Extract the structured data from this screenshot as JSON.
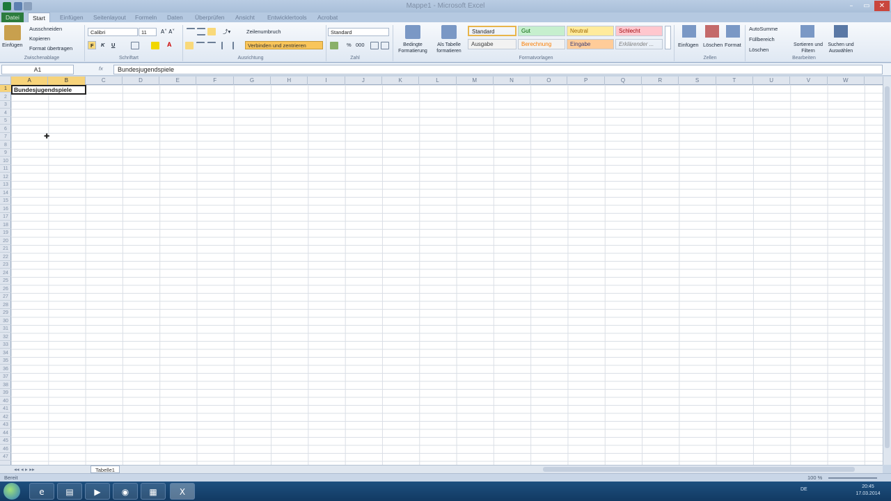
{
  "window": {
    "title": "Mappe1 - Microsoft Excel",
    "minimize": "–",
    "maximize": "▭",
    "close": "✕"
  },
  "tabs": [
    {
      "label": "Datei",
      "active": false,
      "file": true
    },
    {
      "label": "Start",
      "active": true
    },
    {
      "label": "Einfügen"
    },
    {
      "label": "Seitenlayout"
    },
    {
      "label": "Formeln"
    },
    {
      "label": "Daten"
    },
    {
      "label": "Überprüfen"
    },
    {
      "label": "Ansicht"
    },
    {
      "label": "Entwicklertools"
    },
    {
      "label": "Acrobat"
    }
  ],
  "ribbon": {
    "clipboard": {
      "paste": "Einfügen",
      "cut": "Ausschneiden",
      "copy": "Kopieren",
      "format_painter": "Format übertragen",
      "group": "Zwischenablage"
    },
    "font": {
      "name": "Calibri",
      "size": "11",
      "bold": "F",
      "italic": "K",
      "underline": "U",
      "group": "Schriftart"
    },
    "alignment": {
      "wrap": "Zeilenumbruch",
      "merge": "Verbinden und zentrieren",
      "group": "Ausrichtung"
    },
    "number": {
      "format": "Standard",
      "percent": "%",
      "thousands": "000",
      "group": "Zahl"
    },
    "styles": {
      "conditional": "Bedingte Formatierung",
      "as_table": "Als Tabelle formatieren",
      "cells": [
        {
          "label": "Standard",
          "bg": "#ffffff"
        },
        {
          "label": "Gut",
          "bg": "#c6efce"
        },
        {
          "label": "Neutral",
          "bg": "#ffeb9c"
        },
        {
          "label": "Schlecht",
          "bg": "#ffc7ce"
        },
        {
          "label": "Ausgabe",
          "bg": "#f2f2f2"
        },
        {
          "label": "Berechnung",
          "bg": "#f2f2f2"
        },
        {
          "label": "Eingabe",
          "bg": "#ffcc99"
        },
        {
          "label": "Erklärender ...",
          "bg": "#ffffff"
        }
      ],
      "group": "Formatvorlagen"
    },
    "cells_group": {
      "insert": "Einfügen",
      "delete": "Löschen",
      "format": "Format",
      "group": "Zellen"
    },
    "editing": {
      "autosum": "AutoSumme",
      "fill": "Füllbereich",
      "clear": "Löschen",
      "sort": "Sortieren und Filtern",
      "find": "Suchen und Auswählen",
      "group": "Bearbeiten"
    }
  },
  "formula_bar": {
    "name_box": "A1",
    "fx": "fx",
    "content": "Bundesjugendspiele"
  },
  "grid": {
    "columns": [
      "A",
      "B",
      "C",
      "D",
      "E",
      "F",
      "G",
      "H",
      "I",
      "J",
      "K",
      "L",
      "M",
      "N",
      "O",
      "P",
      "Q",
      "R",
      "S",
      "T",
      "U",
      "V",
      "W"
    ],
    "rows": [
      "1",
      "2",
      "3",
      "4",
      "5",
      "6",
      "7",
      "8",
      "9",
      "10",
      "11",
      "12",
      "13",
      "14",
      "15",
      "16",
      "17",
      "18",
      "19",
      "20",
      "21",
      "22",
      "23",
      "24",
      "25",
      "26",
      "27",
      "28",
      "29",
      "30",
      "31",
      "32",
      "33",
      "34",
      "35",
      "36",
      "37",
      "38",
      "39",
      "40",
      "41",
      "42",
      "43",
      "44",
      "45",
      "46",
      "47"
    ],
    "selected_cell": "A1",
    "cell_a1": "Bundesjugendspiele"
  },
  "sheets": [
    "Tabelle1"
  ],
  "status": {
    "ready": "Bereit",
    "zoom": "100 %"
  },
  "taskbar": {
    "time": "20:45",
    "date": "17.03.2014",
    "lang": "DE"
  }
}
